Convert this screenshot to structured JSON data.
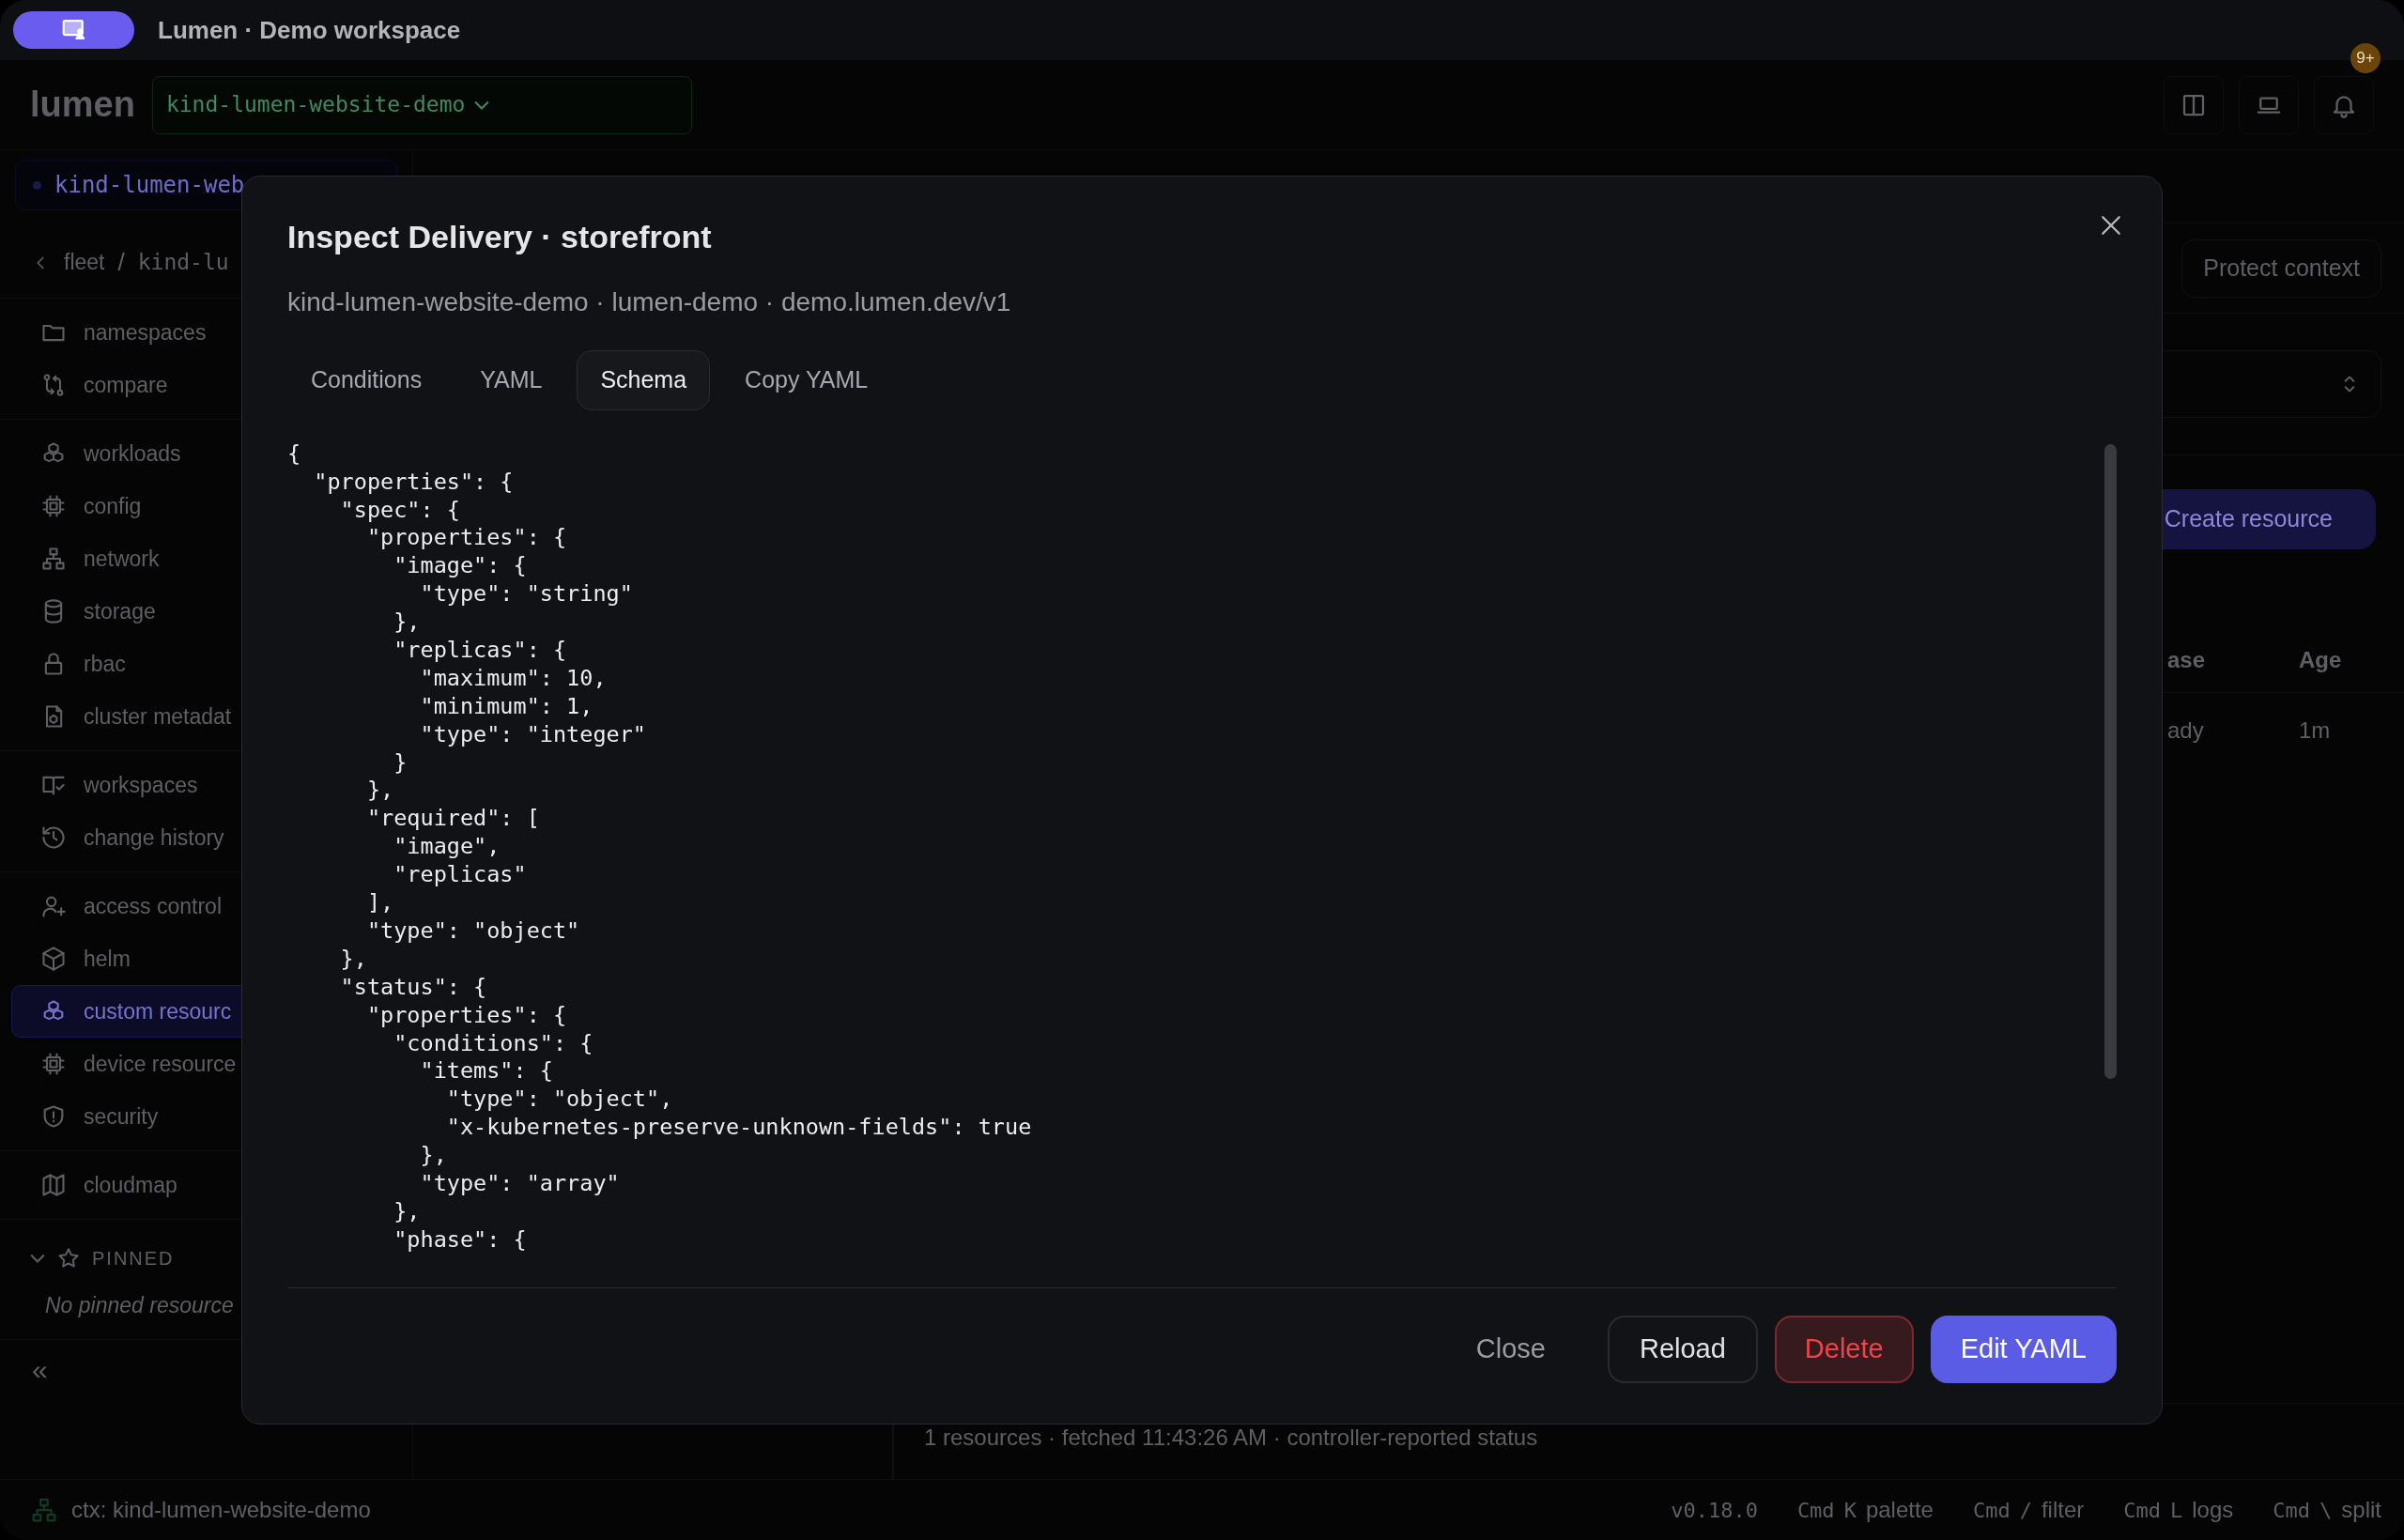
{
  "title_bar": {
    "title": "Lumen · Demo workspace"
  },
  "header": {
    "brand": "lumen",
    "context": "kind-lumen-website-demo",
    "notification_badge": "9+"
  },
  "sidebar": {
    "context_chip": "kind-lumen-web",
    "breadcrumb": [
      "fleet",
      "kind-lu"
    ],
    "breadcrumb_separator": "/",
    "nav_groups": [
      {
        "items": [
          {
            "label": "namespaces",
            "selected": false
          },
          {
            "label": "compare",
            "selected": false
          }
        ]
      },
      {
        "items": [
          {
            "label": "workloads",
            "selected": false
          },
          {
            "label": "config",
            "selected": false
          },
          {
            "label": "network",
            "selected": false
          },
          {
            "label": "storage",
            "selected": false
          },
          {
            "label": "rbac",
            "selected": false
          },
          {
            "label": "cluster metadat",
            "selected": false
          }
        ]
      },
      {
        "items": [
          {
            "label": "workspaces",
            "selected": false
          },
          {
            "label": "change history",
            "selected": false
          }
        ]
      },
      {
        "items": [
          {
            "label": "access control",
            "selected": false
          },
          {
            "label": "helm",
            "selected": false
          },
          {
            "label": "custom resourc",
            "selected": true
          },
          {
            "label": "device resource",
            "selected": false
          },
          {
            "label": "security",
            "selected": false
          }
        ]
      },
      {
        "items": [
          {
            "label": "cloudmap",
            "selected": false
          }
        ]
      }
    ],
    "pinned": {
      "heading": "PINNED",
      "empty": "No pinned resource"
    },
    "collapse": "«"
  },
  "main": {
    "protect_button": "Protect context",
    "create_button": "Create resource",
    "table": {
      "columns": [
        "ase",
        "Age"
      ],
      "rows": [
        [
          "ady",
          "1m"
        ]
      ]
    },
    "footer": "1 resources · fetched 11:43:26 AM · controller-reported status"
  },
  "dialog": {
    "title": "Inspect Delivery · storefront",
    "subtitle": "kind-lumen-website-demo · lumen-demo · demo.lumen.dev/v1",
    "tabs": [
      {
        "label": "Conditions",
        "selected": false
      },
      {
        "label": "YAML",
        "selected": false
      },
      {
        "label": "Schema",
        "selected": true
      },
      {
        "label": "Copy YAML",
        "selected": false
      }
    ],
    "code_lines": [
      "{",
      "  \"properties\": {",
      "    \"spec\": {",
      "      \"properties\": {",
      "        \"image\": {",
      "          \"type\": \"string\"",
      "        },",
      "        \"replicas\": {",
      "          \"maximum\": 10,",
      "          \"minimum\": 1,",
      "          \"type\": \"integer\"",
      "        }",
      "      },",
      "      \"required\": [",
      "        \"image\",",
      "        \"replicas\"",
      "      ],",
      "      \"type\": \"object\"",
      "    },",
      "    \"status\": {",
      "      \"properties\": {",
      "        \"conditions\": {",
      "          \"items\": {",
      "            \"type\": \"object\",",
      "            \"x-kubernetes-preserve-unknown-fields\": true",
      "          },",
      "          \"type\": \"array\"",
      "        },",
      "        \"phase\": {"
    ],
    "buttons": [
      {
        "label": "Close",
        "kind": "plain"
      },
      {
        "label": "Reload",
        "kind": "outline"
      },
      {
        "label": "Delete",
        "kind": "danger"
      },
      {
        "label": "Edit YAML",
        "kind": "primary"
      }
    ]
  },
  "status_bar": {
    "context": "ctx: kind-lumen-website-demo",
    "version": "v0.18.0",
    "shortcuts": [
      {
        "keys": [
          "Cmd",
          "K"
        ],
        "label": "palette"
      },
      {
        "keys": [
          "Cmd",
          "/"
        ],
        "label": "filter"
      },
      {
        "keys": [
          "Cmd",
          "L"
        ],
        "label": "logs"
      },
      {
        "keys": [
          "Cmd",
          "\\"
        ],
        "label": "split"
      }
    ]
  }
}
